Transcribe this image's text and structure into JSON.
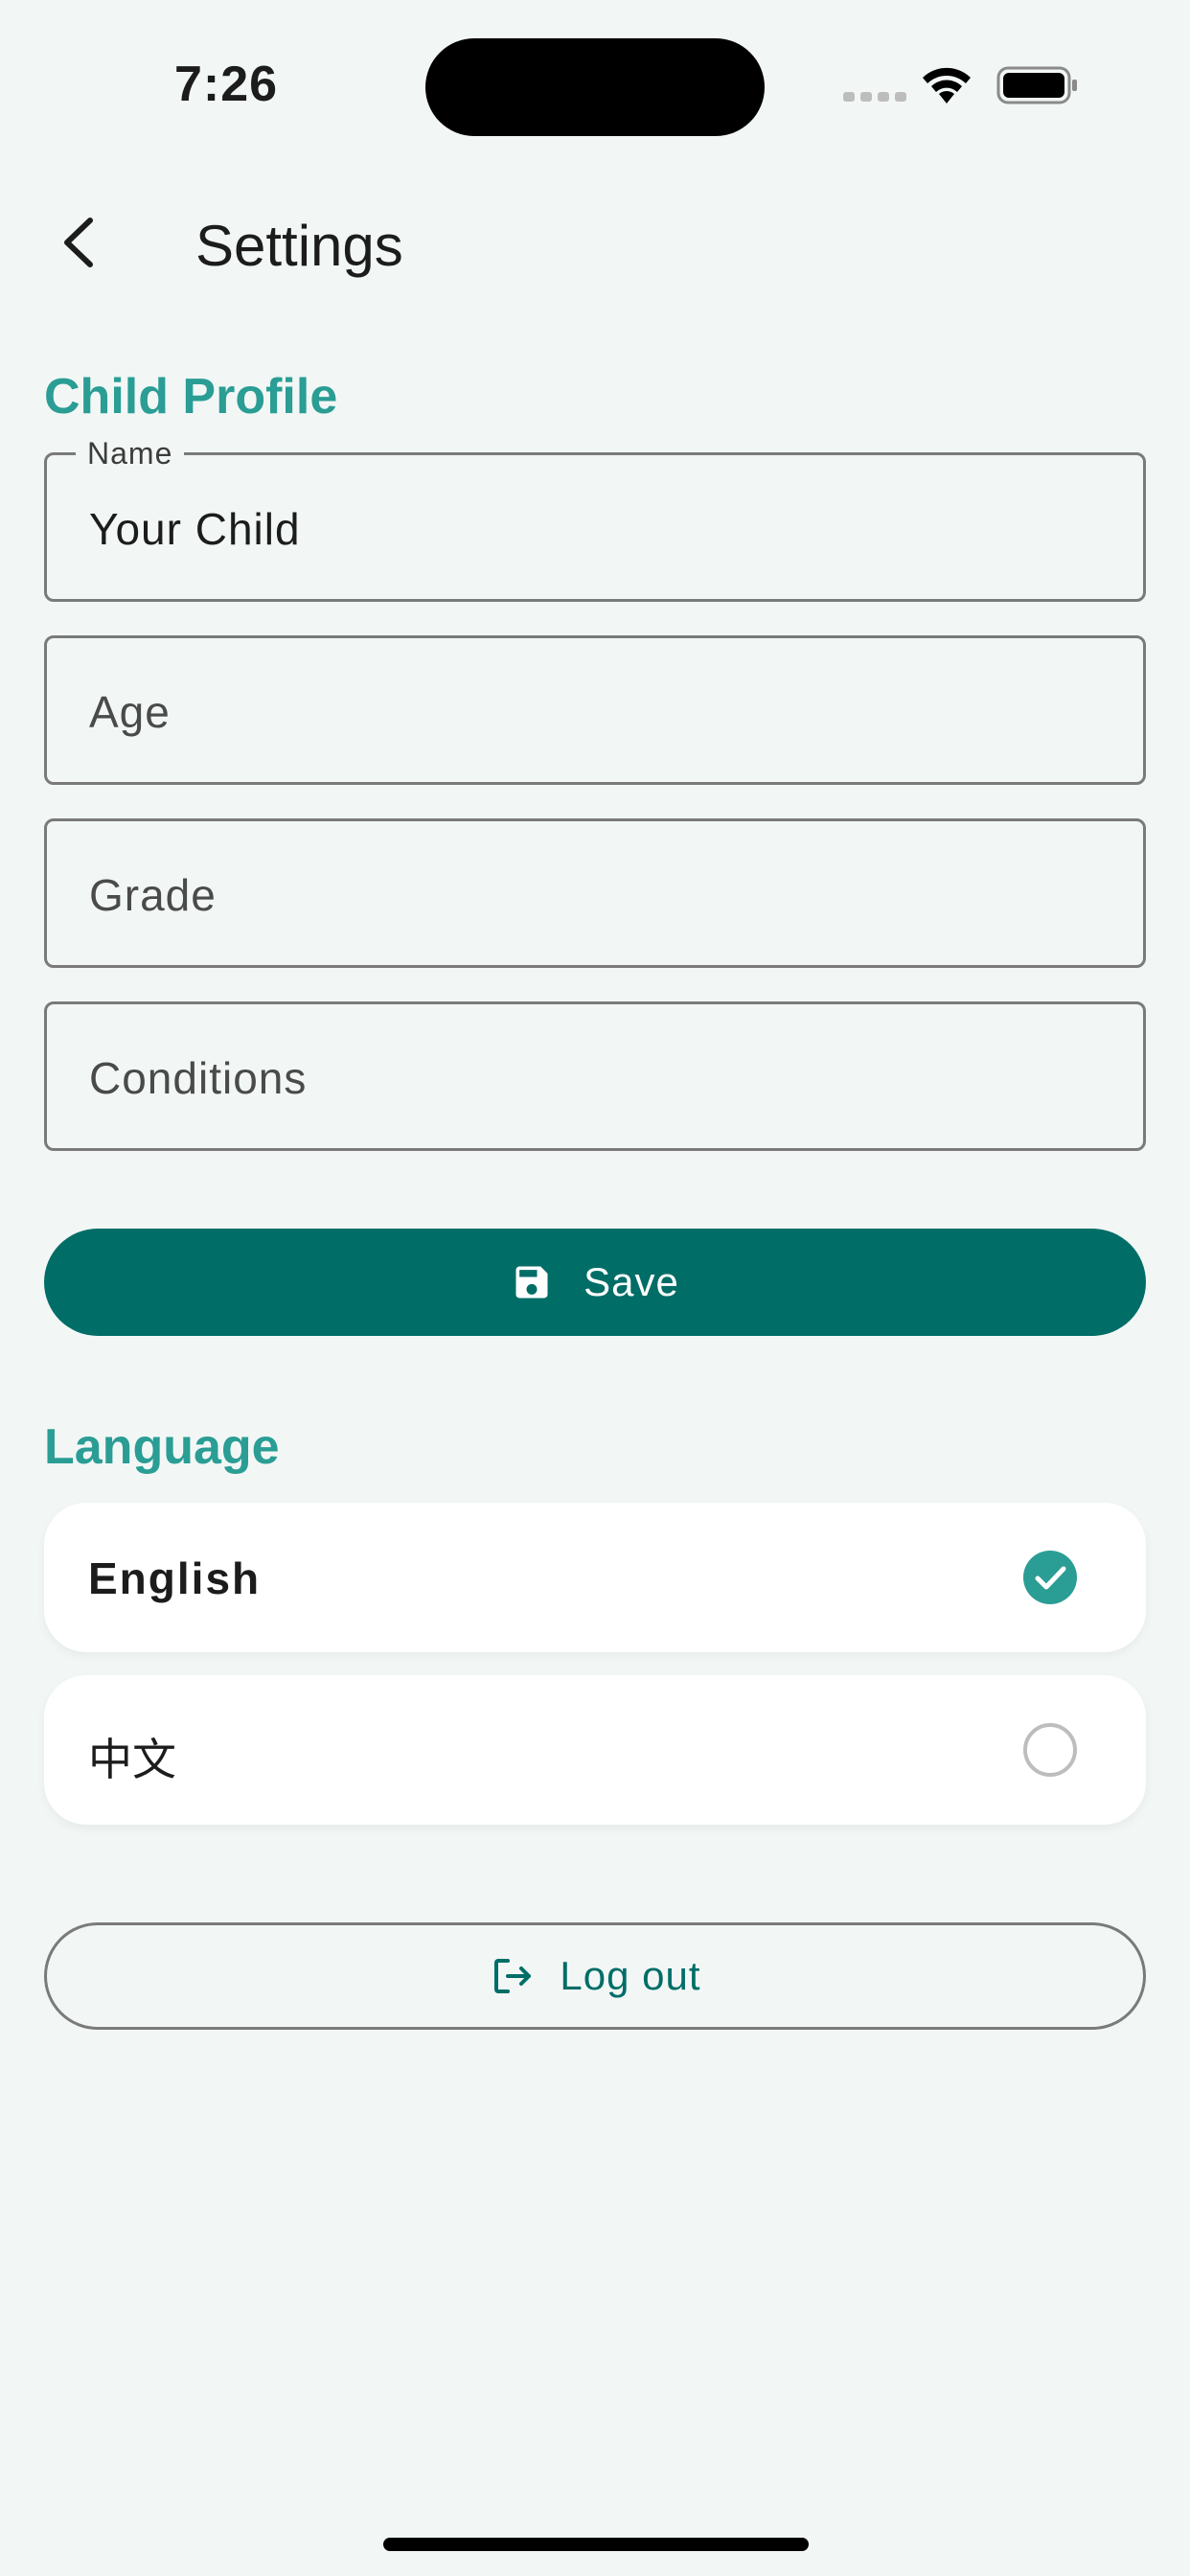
{
  "status_bar": {
    "time": "7:26"
  },
  "app_bar": {
    "title": "Settings",
    "back_icon": "chevron-left-icon"
  },
  "child_profile": {
    "section_title": "Child Profile",
    "fields": {
      "name": {
        "label": "Name",
        "value": "Your Child"
      },
      "age": {
        "placeholder": "Age"
      },
      "grade": {
        "placeholder": "Grade"
      },
      "conditions": {
        "placeholder": "Conditions"
      }
    },
    "save_button": {
      "label": "Save",
      "icon": "save-icon"
    }
  },
  "language": {
    "section_title": "Language",
    "options": [
      {
        "label": "English",
        "selected": true
      },
      {
        "label": "中文",
        "selected": false
      }
    ]
  },
  "logout_button": {
    "label": "Log out",
    "icon": "logout-icon"
  },
  "colors": {
    "background": "#f2f7f6",
    "accent_section": "#2a9d94",
    "primary": "#006d67",
    "check_fill": "#2a9d94",
    "outline": "#7a7a7a"
  }
}
